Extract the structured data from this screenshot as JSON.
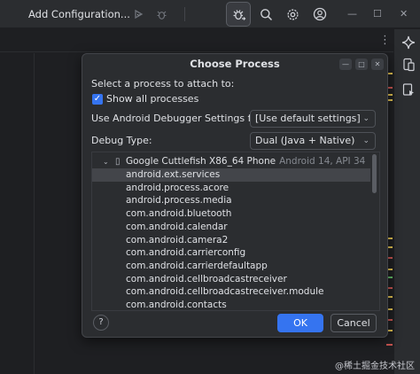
{
  "toolbar": {
    "run_config_label": "Add Configuration...",
    "icons": [
      "run-icon",
      "debug-icon",
      "attach-debugger-icon",
      "search-icon",
      "settings-icon",
      "account-icon"
    ]
  },
  "dialog": {
    "title": "Choose Process",
    "select_prompt": "Select a process to attach to:",
    "show_all_label": "Show all processes",
    "show_all_checked": true,
    "debugger_settings_label": "Use Android Debugger Settings from:",
    "debugger_settings_value": "[Use default settings]",
    "debug_type_label": "Debug Type:",
    "debug_type_value": "Dual (Java + Native)",
    "device": {
      "name": "Google Cuttlefish X86_64 Phone",
      "api": "Android 14, API 34"
    },
    "processes": [
      "android.ext.services",
      "android.process.acore",
      "android.process.media",
      "com.android.bluetooth",
      "com.android.calendar",
      "com.android.camera2",
      "com.android.carrierconfig",
      "com.android.carrierdefaultapp",
      "com.android.cellbroadcastreceiver",
      "com.android.cellbroadcastreceiver.module",
      "com.android.contacts"
    ],
    "selected_process_index": 0,
    "help_label": "?",
    "ok_label": "OK",
    "cancel_label": "Cancel"
  },
  "watermark": "@稀土掘金技术社区",
  "colors": {
    "accent": "#3574f0",
    "background": "#1e1f22",
    "panel": "#2b2d30"
  }
}
